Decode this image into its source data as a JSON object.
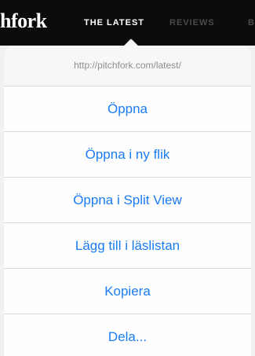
{
  "site_nav": {
    "logo": "hfork",
    "items": [
      "THE LATEST",
      "REVIEWS",
      "B"
    ]
  },
  "popover": {
    "url": "http://pitchfork.com/latest/",
    "actions": [
      "Öppna",
      "Öppna i ny flik",
      "Öppna i Split View",
      "Lägg till i läslistan",
      "Kopiera",
      "Dela..."
    ]
  },
  "colors": {
    "action_text": "#1a7cf4",
    "url_text": "#8e8e93",
    "nav_background": "#0c0c0c"
  }
}
